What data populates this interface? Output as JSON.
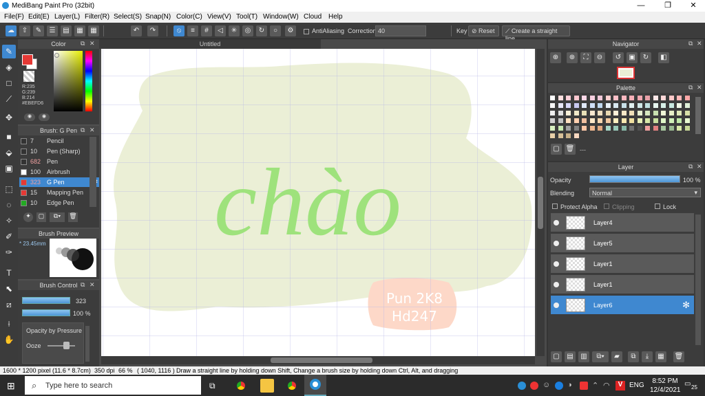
{
  "window": {
    "title": "MediBang Paint Pro (32bit)",
    "minimize": "—",
    "maximize": "❐",
    "close": "✕"
  },
  "menu": [
    "File(F)",
    "Edit(E)",
    "Layer(L)",
    "Filter(R)",
    "Select(S)",
    "Snap(N)",
    "Color(C)",
    "View(V)",
    "Tool(T)",
    "Window(W)",
    "Cloud",
    "Help"
  ],
  "toolbar": {
    "antialiasing_label": "AntiAliasing",
    "correction_label": "Correction",
    "correction_value": "40",
    "key_label": "Key",
    "reset_label": "Reset",
    "straight_line_label": "Create a straight line"
  },
  "color_panel": {
    "title": "Color",
    "r": "R:235",
    "g": "G:239",
    "b": "B:214",
    "hex": "#EBEFD6",
    "fg_color": "#e53935",
    "bg_color": "#ffffff"
  },
  "brush_panel": {
    "title": "Brush: G Pen",
    "brushes": [
      {
        "size": "7",
        "name": "Pencil",
        "color": "#333333"
      },
      {
        "size": "10",
        "name": "Pen (Sharp)",
        "color": "#333333"
      },
      {
        "size": "682",
        "name": "Pen",
        "color": "#333333",
        "size_color": "#f0a0a0"
      },
      {
        "size": "100",
        "name": "Airbrush",
        "color": "#ffffff"
      },
      {
        "size": "323",
        "name": "G Pen",
        "color": "#e53935",
        "selected": true,
        "size_color": "#f0a0a0"
      },
      {
        "size": "15",
        "name": "Mapping Pen",
        "color": "#e53935"
      },
      {
        "size": "10",
        "name": "Edge Pen",
        "color": "#22aa22"
      }
    ]
  },
  "brush_preview": {
    "title": "Brush Preview",
    "size": "* 23.45mm"
  },
  "brush_control": {
    "title": "Brush Control",
    "size": "323",
    "opacity": "100 %",
    "opacity_by_pressure": "Opacity by Pressure",
    "ooze": "Ooze"
  },
  "canvas": {
    "tab": "Untitled",
    "text_main": "chào",
    "sign_line1": "Pun 2K8",
    "sign_line2": "Hd247"
  },
  "navigator": {
    "title": "Navigator"
  },
  "palette": {
    "title": "Palette",
    "colors": [
      "#ffffff",
      "#ffe0e0",
      "#ffd0d8",
      "#ffc8d0",
      "#ffd8e8",
      "#f8d0e0",
      "#f0c8d8",
      "#ffd0d0",
      "#ffc0c8",
      "#ffb8c0",
      "#f8b0b8",
      "#f0a8b0",
      "#e8a0a8",
      "#ffe8e8",
      "#ffd8d8",
      "#ffc8c8",
      "#ffb8b8",
      "#ffa8a8",
      "#f8f8f8",
      "#e8e8f8",
      "#d8d8f8",
      "#c8c8f0",
      "#e0e8f8",
      "#d0e0f8",
      "#c0d8f0",
      "#e8f0f8",
      "#d8e8f0",
      "#c8e0e8",
      "#e0f0f0",
      "#d0e8e8",
      "#c0e0e0",
      "#e8f8f0",
      "#d8f0e8",
      "#c8e8e0",
      "#f0f8e8",
      "#e0f0d8",
      "#f0f0f0",
      "#e0e0e0",
      "#f8f0d8",
      "#f0e8c8",
      "#e8e0b8",
      "#f8e8d0",
      "#f0e0c0",
      "#e8d8b0",
      "#fff0d8",
      "#f8e8c8",
      "#f0e0b8",
      "#e8f0d0",
      "#d8e8c0",
      "#c8e0b0",
      "#f0f8d8",
      "#e8f0c8",
      "#e0e8b8",
      "#d8e0a8",
      "#d0d0d0",
      "#c0c0c0",
      "#ffe0c0",
      "#ffd0b0",
      "#f0c0a0",
      "#ffe8c8",
      "#f8d8b0",
      "#f0c8a0",
      "#fff0c0",
      "#f8e8b0",
      "#f0e0a0",
      "#e8f0b8",
      "#d8e8a8",
      "#c8e0a0",
      "#e0f8c8",
      "#d0f0b8",
      "#c0e8a8",
      "#e8f8d0",
      "#d8f0c0",
      "#c8e8b0",
      "#a0a0a0",
      "#808080",
      "#ffc8a8",
      "#f0b890",
      "#e0a880",
      "#a8d8c8",
      "#98c8b8",
      "#88b8a8",
      "#707070",
      "#505050",
      "#f0a0a0",
      "#e08080",
      "#a8c8a0",
      "#98b890",
      "#d8e8a8",
      "#c8d898",
      "#e8d0a8",
      "#d8c098",
      "#c8b088",
      "#f8d8c0"
    ]
  },
  "layer_panel": {
    "title": "Layer",
    "opacity_label": "Opacity",
    "opacity_value": "100 %",
    "opacity_level": 1.0,
    "blending_label": "Blending",
    "blending_value": "Normal",
    "protect_alpha": "Protect Alpha",
    "clipping": "Clipping",
    "lock": "Lock",
    "layers": [
      {
        "name": "Layer4",
        "selected": false
      },
      {
        "name": "Layer5",
        "selected": false
      },
      {
        "name": "Layer1",
        "selected": false
      },
      {
        "name": "Layer1",
        "selected": false
      },
      {
        "name": "Layer6",
        "selected": true
      }
    ]
  },
  "status": {
    "dimensions": "1600 * 1200 pixel",
    "size_cm": "(11.6 * 8.7cm)",
    "dpi": "350 dpi",
    "zoom": "66 %",
    "coords": "( 1040, 1116 )",
    "hint": "Draw a straight line by holding down Shift, Change a brush size by holding down Ctrl, Alt, and dragging"
  },
  "taskbar": {
    "search_placeholder": "Type here to search",
    "time": "8:52 PM",
    "date": "12/4/2021",
    "language": "ENG",
    "notifications": "25"
  }
}
